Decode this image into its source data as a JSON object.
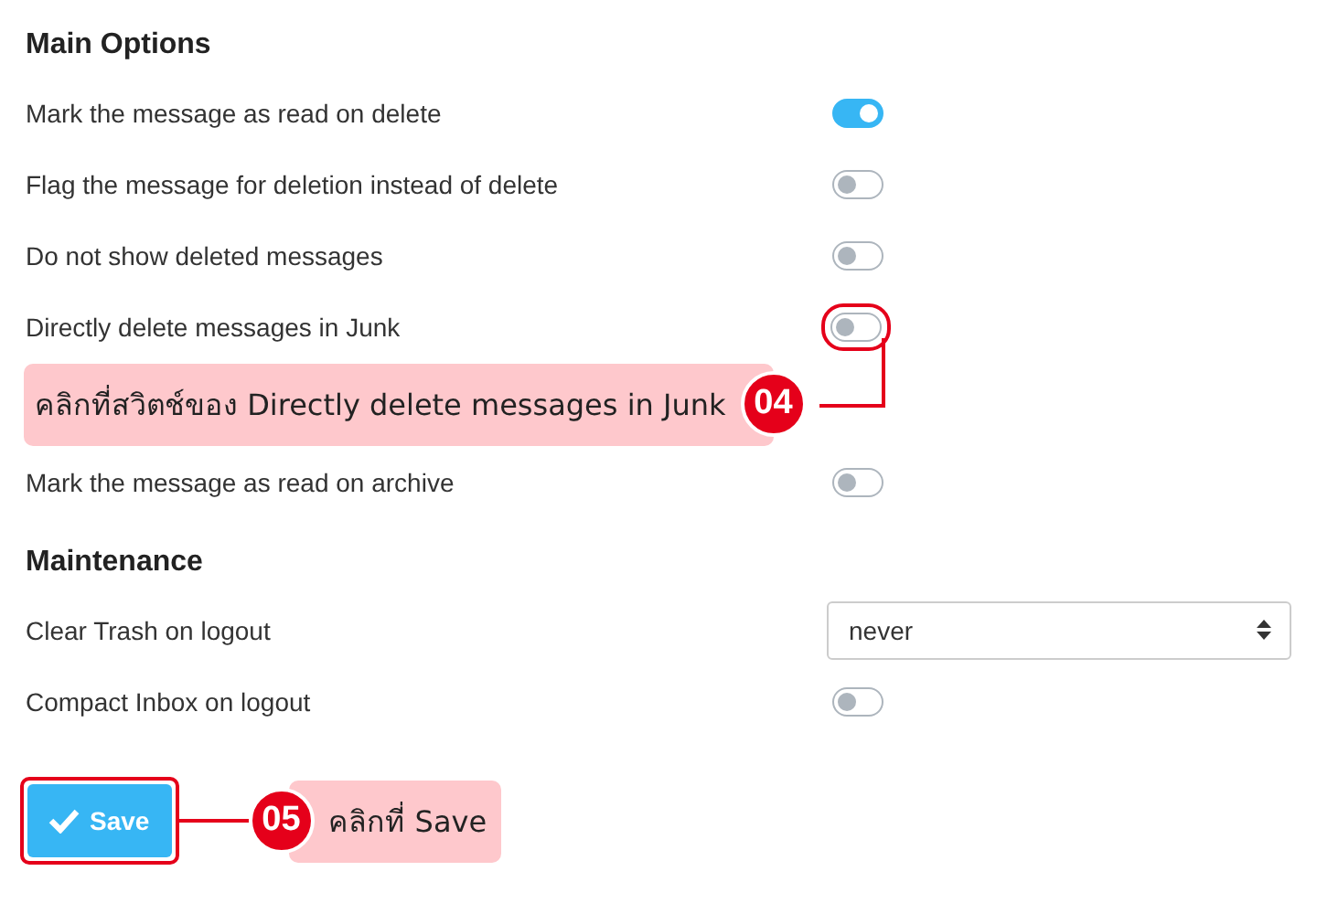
{
  "main_options": {
    "title": "Main Options",
    "items": [
      {
        "kind": "toggle",
        "label": "Mark the message as read on delete",
        "on": true
      },
      {
        "kind": "toggle",
        "label": "Flag the message for deletion instead of delete",
        "on": false
      },
      {
        "kind": "toggle",
        "label": "Do not show deleted messages",
        "on": false
      },
      {
        "kind": "toggle",
        "label": "Directly delete messages in Junk",
        "on": false,
        "callout": {
          "number": "04",
          "text": "คลิกที่สวิตช์ของ Directly delete messages in Junk"
        }
      },
      {
        "kind": "toggle",
        "label": "Mark the message as read on archive",
        "on": false
      }
    ]
  },
  "maintenance": {
    "title": "Maintenance",
    "items": [
      {
        "kind": "select",
        "label": "Clear Trash on logout",
        "value": "never"
      },
      {
        "kind": "toggle",
        "label": "Compact Inbox on logout",
        "on": false
      }
    ]
  },
  "save_button": {
    "label": "Save",
    "callout": {
      "number": "05",
      "text": "คลิกที่ Save"
    }
  }
}
